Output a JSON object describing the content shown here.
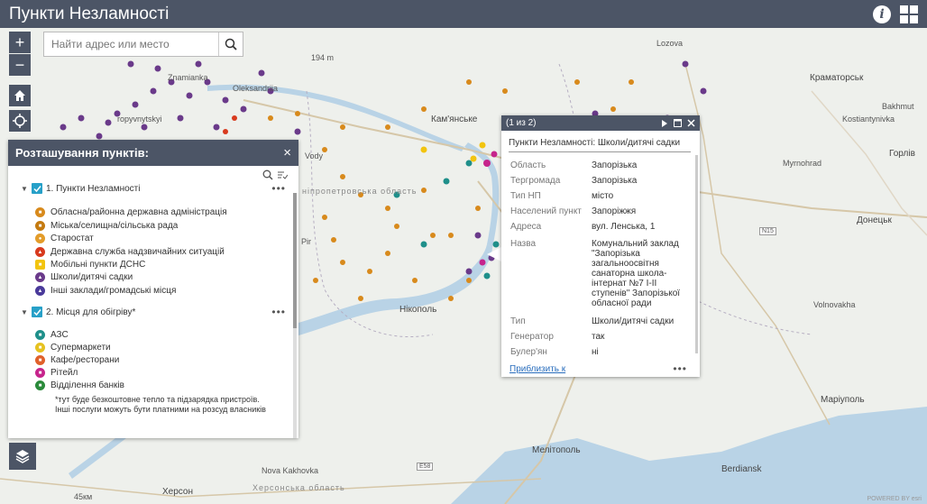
{
  "header": {
    "title": "Пункти Незламності",
    "info_icon": "info-icon",
    "apps_icon": "grid-icon"
  },
  "search": {
    "placeholder": "Найти адрес или место",
    "icon": "search-icon"
  },
  "map_controls": {
    "zoom_in": "+",
    "zoom_out": "−",
    "home_icon": "home-icon",
    "locate_icon": "locate-icon",
    "layers_icon": "layers-icon"
  },
  "places": {
    "lozova": "Lozova",
    "kramatorsk": "Краматорськ",
    "bakhmut": "Bakhmut",
    "kostiantynivka": "Kostiantynivka",
    "horlivka": "Горлів",
    "myrnohrad": "Myrnohrad",
    "donetsk": "Донецьк",
    "volnovakha": "Volnovakha",
    "mariupol": "Маріуполь",
    "berdiansk": "Berdiansk",
    "melitopol": "Мелітополь",
    "nova_kakhovka": "Nova Kakhovka",
    "kherson": "Херсон",
    "nikopol": "Нікополь",
    "kamianske": "Кам'янське",
    "oleksandriia": "Oleksandriia",
    "znamianka": "Znamianka",
    "kropyvnytskyi": "ropyvnytskyi",
    "vody": "Vody",
    "pir": "Pir",
    "dnipro_region": "ніпропетровська область",
    "kherson_region": "Херсонська область"
  },
  "road_labels": {
    "n15": "N15",
    "e58": "E58",
    "dist_194": "194 m",
    "dist_45": "45км"
  },
  "legend": {
    "title": "Розташування пунктів:",
    "close": "×",
    "group1": {
      "label": "1. Пункти Незламності",
      "items": [
        "Обласна/районна державна адміністрація",
        "Міська/селищна/сільська рада",
        "Старостат",
        "Державна служба надзвичайних ситуацій",
        "Мобільні пункти ДСНС",
        "Школи/дитячі садки",
        "Інші заклади/громадські місця"
      ]
    },
    "group2": {
      "label": "2. Місця для обігріву*",
      "items": [
        "АЗС",
        "Супермаркети",
        "Кафе/ресторани",
        "Рітейл",
        "Відділення банків"
      ]
    },
    "footnote": "*тут буде безкоштовне тепло та підзарядка пристроїв. Інші послуги можуть бути платними на розсуд власників",
    "more": "•••",
    "symbol_colors": {
      "admin": "#d88a1c",
      "council": "#c47a10",
      "starostat": "#e39c2a",
      "dsns": "#d83a1e",
      "mobile": "#f2c40f",
      "schools": "#6a3a8a",
      "other": "#4a3a9a",
      "azs": "#1f8f8a",
      "supermarket": "#e6c220",
      "cafe": "#e0602a",
      "retail": "#c6248c",
      "bank": "#2a8a3a"
    }
  },
  "popup": {
    "counter": "(1 из 2)",
    "title": "Пункти Незламності: Школи/дитячі садки",
    "attributes": [
      {
        "key": "Область",
        "value": "Запорізька"
      },
      {
        "key": "Тергромада",
        "value": "Запорізька"
      },
      {
        "key": "Тип НП",
        "value": "місто"
      },
      {
        "key": "Населений пункт",
        "value": "Запоріжжя"
      },
      {
        "key": "Адреса",
        "value": "вул. Ленська, 1"
      },
      {
        "key": "Назва",
        "value": "Комунальний заклад \"Запорізька загальноосвітня санаторна школа-інтернат №7 І-ІІ ступенів\" Запорізької обласної ради"
      },
      {
        "key": "Тип",
        "value": "Школи/дитячі садки"
      },
      {
        "key": "Генератор",
        "value": "так"
      },
      {
        "key": "Булер'ян",
        "value": "ні"
      }
    ],
    "zoom_link": "Приблизить к",
    "more": "•••"
  },
  "attribution": "POWERED BY esri"
}
